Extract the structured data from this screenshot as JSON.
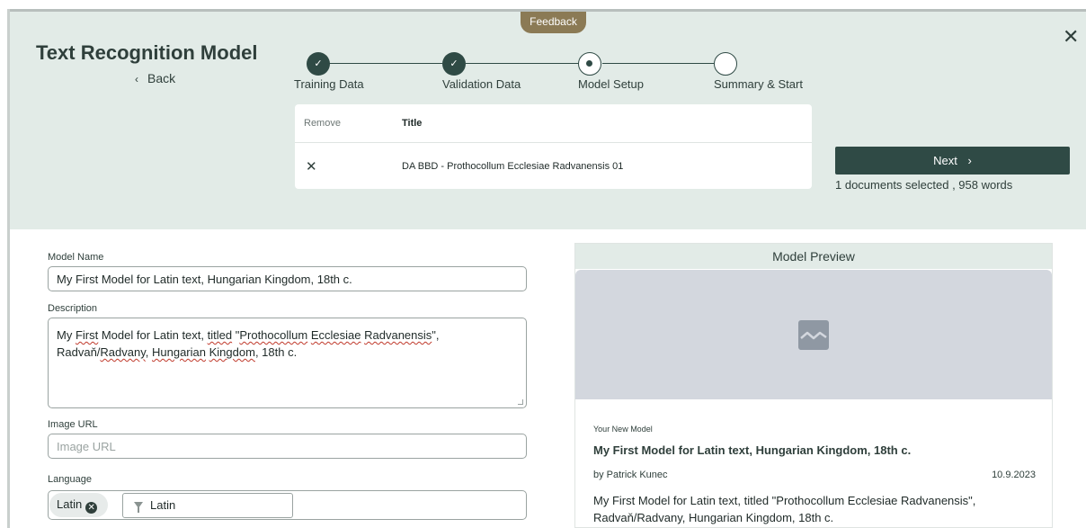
{
  "window": {
    "title": "Text Recognition Model",
    "back_label": "Back",
    "close_icon": "close-icon",
    "feedback_label": "Feedback"
  },
  "stepper": {
    "steps": [
      {
        "label": "Training Data",
        "state": "done"
      },
      {
        "label": "Validation Data",
        "state": "done"
      },
      {
        "label": "Model Setup",
        "state": "active"
      },
      {
        "label": "Summary & Start",
        "state": "todo"
      }
    ]
  },
  "documents_table": {
    "columns": [
      "Remove",
      "Title"
    ],
    "rows": [
      {
        "remove_icon": "close-icon",
        "title": "DA BBD - Prothocollum Ecclesiae Radvanensis 01"
      }
    ]
  },
  "actions": {
    "next_label": "Next",
    "selection_summary": "1 documents selected , 958 words"
  },
  "form": {
    "model_name_label": "Model Name",
    "model_name_value": "My First Model for Latin text, Hungarian Kingdom, 18th c.",
    "description_label": "Description",
    "description_value": "My First Model for Latin text, titled \"Prothocollum Ecclesiae Radvanensis\", Radvaň/Radvany, Hungarian Kingdom, 18th c.",
    "image_url_label": "Image URL",
    "image_url_placeholder": "Image URL",
    "language_label": "Language",
    "language_chip": "Latin",
    "language_filter_value": "Latin"
  },
  "preview": {
    "header": "Model Preview",
    "image_icon": "image-placeholder-icon",
    "kicker": "Your New Model",
    "name": "My First Model for Latin text, Hungarian Kingdom, 18th c.",
    "author": "by Patrick Kunec",
    "date": "10.9.2023",
    "description": "My First Model for Latin text, titled \"Prothocollum Ecclesiae Radvanensis\", Radvaň/Radvany, Hungarian Kingdom, 18th c."
  },
  "colors": {
    "accent": "#2f4a45",
    "header_bg": "#e2ebe7",
    "feedback": "#8b7a55"
  }
}
